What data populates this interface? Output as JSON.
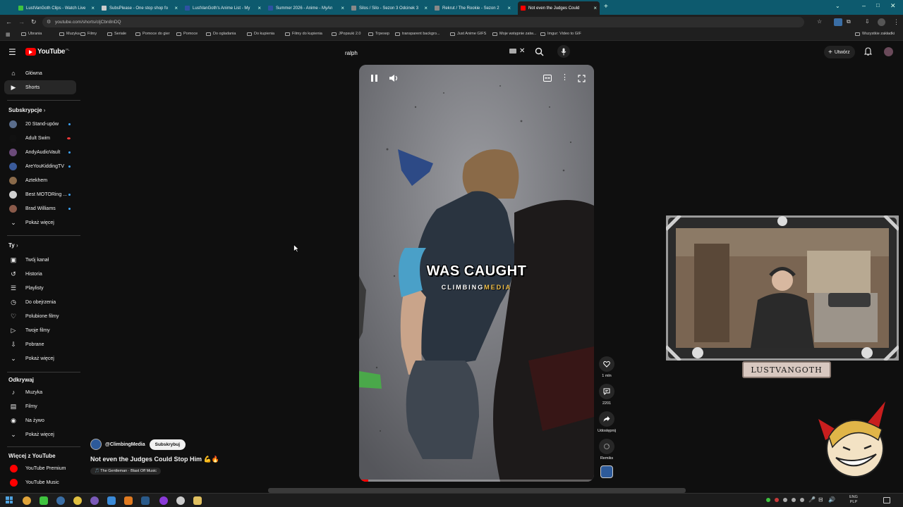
{
  "browser": {
    "tabs": [
      {
        "label": "LustVanGoth Clips - Watch Live",
        "color": "#3fc33f"
      },
      {
        "label": "SubsPlease - One stop shop fo",
        "color": "#cccccc"
      },
      {
        "label": "LustVanGoth's Anime List - My",
        "color": "#2e51a2"
      },
      {
        "label": "Summer 2026 - Anime - MyAn",
        "color": "#2e51a2"
      },
      {
        "label": "Silos / Silo - Sezon 3 Odcinek 3",
        "color": "#888888"
      },
      {
        "label": "Rekrut / The Rookie - Sezon 2",
        "color": "#888888"
      },
      {
        "label": "Not even the Judges Could",
        "color": "#ff0000"
      }
    ],
    "url": "youtube.com/shorts/cljCbn8nDQ",
    "bookmarks": [
      "Ubrania",
      "Muzyka",
      "Filmy",
      "Seriale",
      "Pomoce do gier",
      "Pomoce",
      "Do ogladania",
      "Do kupienia",
      "Filmy do kupienia",
      "JPopsuki 2.0",
      "Trpexep",
      "transparent backgro...",
      "Just Anime GIFS",
      "Moje wstępnie zatw...",
      "Imgur: Video to GIF"
    ],
    "all_bookmarks": "Wszystkie zakładki"
  },
  "header": {
    "logo_text": "YouTube",
    "logo_country": "PL",
    "search_value": "ralph",
    "create_label": "Utwórz"
  },
  "sidebar": {
    "main": [
      {
        "label": "Główna",
        "icon": "home-icon"
      },
      {
        "label": "Shorts",
        "icon": "shorts-icon"
      }
    ],
    "subscriptions_title": "Subskrypcje",
    "subscriptions": [
      {
        "label": "20 Stand-upów",
        "color": "#5a6d8c",
        "badge": "dot"
      },
      {
        "label": "Adult Swim",
        "color": "#111111",
        "badge": "live"
      },
      {
        "label": "AndyAudioVault",
        "color": "#6b4a7a",
        "badge": "dot"
      },
      {
        "label": "AreYouKiddingTV",
        "color": "#3a5a9a",
        "badge": "dot"
      },
      {
        "label": "Aztekhem",
        "color": "#8a6a4a",
        "badge": ""
      },
      {
        "label": "Best MOTORing ...",
        "color": "#d0d0d0",
        "badge": "dot"
      },
      {
        "label": "Brad Williams",
        "color": "#8a5a4a",
        "badge": "dot"
      }
    ],
    "show_more": "Pokaż więcej",
    "you_title": "Ty",
    "you_items": [
      {
        "label": "Twój kanał",
        "icon": "channel-icon"
      },
      {
        "label": "Historia",
        "icon": "history-icon"
      },
      {
        "label": "Playlisty",
        "icon": "playlist-icon"
      },
      {
        "label": "Do obejrzenia",
        "icon": "watch-later-icon"
      },
      {
        "label": "Polubione filmy",
        "icon": "like-icon"
      },
      {
        "label": "Twoje filmy",
        "icon": "your-videos-icon"
      },
      {
        "label": "Pobrane",
        "icon": "download-icon"
      }
    ],
    "explore_title": "Odkrywaj",
    "explore_items": [
      {
        "label": "Muzyka",
        "icon": "music-icon"
      },
      {
        "label": "Filmy",
        "icon": "movies-icon"
      },
      {
        "label": "Na żywo",
        "icon": "live-icon"
      }
    ],
    "more_title": "Więcej z YouTube",
    "more_items": [
      {
        "label": "YouTube Premium"
      },
      {
        "label": "YouTube Music"
      }
    ]
  },
  "video": {
    "caption_main": "WAS CAUGHT",
    "caption_sub_1": "CLIMBING",
    "caption_sub_2": "MEDIA",
    "progress_fraction": 0.04,
    "channel": "@ClimbingMedia",
    "subscribe_label": "Subskrybuj",
    "title": "Not even the Judges Could Stop Him 💪🔥",
    "music": "🎵 The Gentleman · Blast Off Music"
  },
  "actions": {
    "likes": "1 mln",
    "comments": "2201",
    "share": "Udostępnij",
    "remix": "Remiks"
  },
  "overlay": {
    "streamer_name": "LUSTVANGOTH"
  },
  "taskbar": {
    "lang_top": "ENG",
    "lang_bottom": "PLP"
  }
}
